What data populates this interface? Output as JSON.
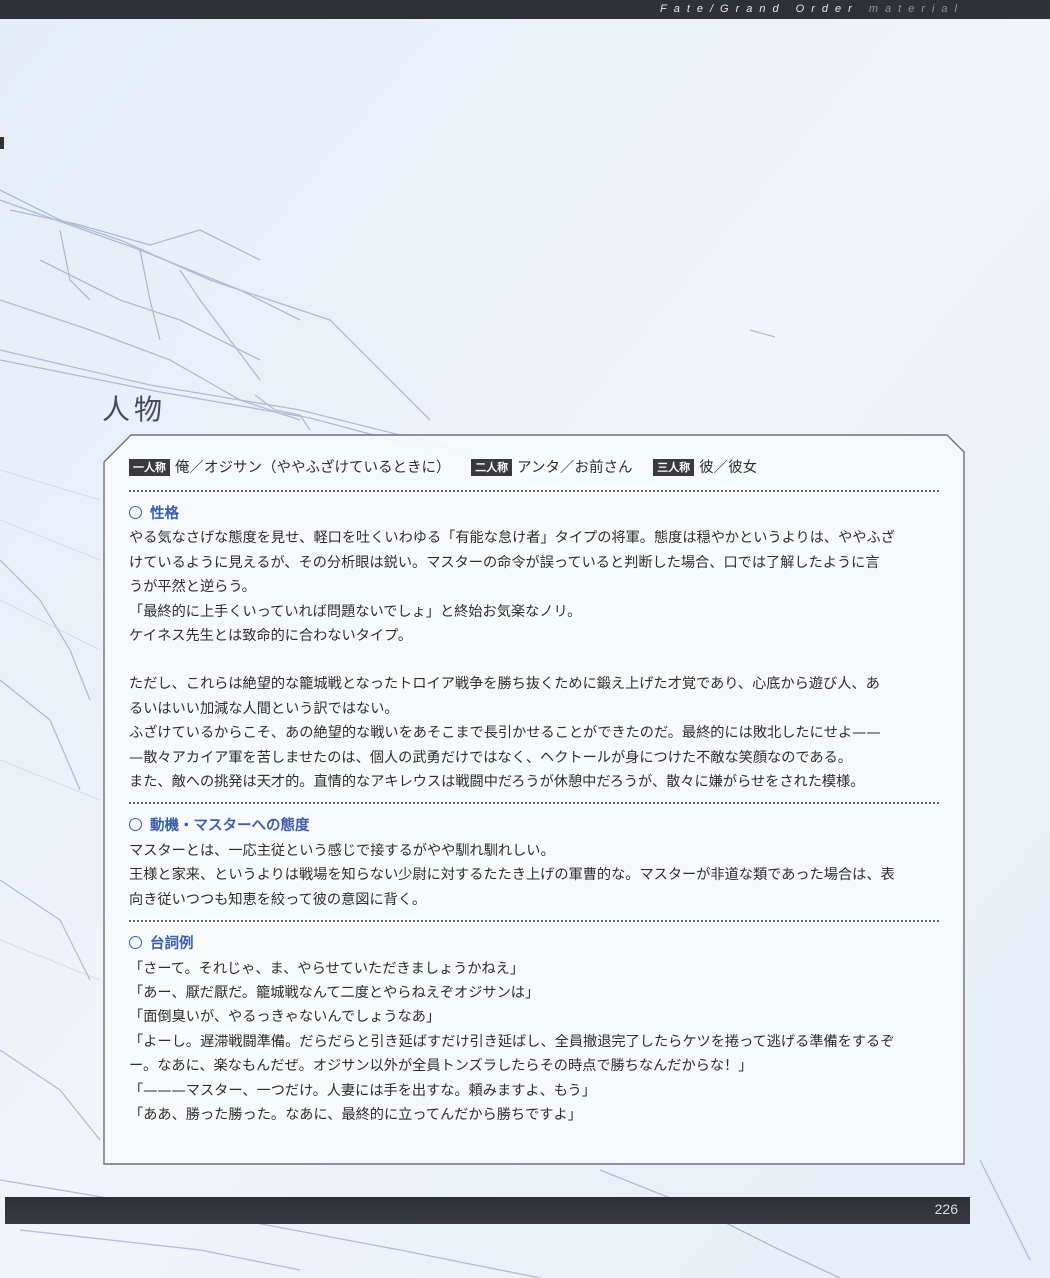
{
  "header": {
    "series_bright": "Fate/Grand Order",
    "series_dim": "material"
  },
  "section_title": "人物",
  "pronouns": {
    "first_label": "一人称",
    "first_value": "俺／オジサン（ややふざけているときに）",
    "second_label": "二人称",
    "second_value": "アンタ／お前さん",
    "third_label": "三人称",
    "third_value": "彼／彼女"
  },
  "personality": {
    "heading": "性格",
    "lines": [
      "やる気なさげな態度を見せ、軽口を吐くいわゆる「有能な怠け者」タイプの将軍。態度は穏やかというよりは、ややふざ",
      "けているように見えるが、その分析眼は鋭い。マスターの命令が誤っていると判断した場合、口では了解したように言",
      "うが平然と逆らう。",
      "「最終的に上手くいっていれば問題ないでしょ」と終始お気楽なノリ。",
      "ケイネス先生とは致命的に合わないタイプ。"
    ],
    "lines2": [
      "ただし、これらは絶望的な籠城戦となったトロイア戦争を勝ち抜くために鍛え上げた才覚であり、心底から遊び人、あ",
      "るいはいい加減な人間という訳ではない。",
      "ふざけているからこそ、あの絶望的な戦いをあそこまで長引かせることができたのだ。最終的には敗北したにせよ——",
      "—散々アカイア軍を苦しませたのは、個人の武勇だけではなく、ヘクトールが身につけた不敵な笑顔なのである。",
      "また、敵への挑発は天才的。直情的なアキレウスは戦闘中だろうが休憩中だろうが、散々に嫌がらせをされた模様。"
    ]
  },
  "motivation": {
    "heading": "動機・マスターへの態度",
    "lines": [
      "マスターとは、一応主従という感じで接するがやや馴れ馴れしい。",
      "王様と家来、というよりは戦場を知らない少尉に対するたたき上げの軍曹的な。マスターが非道な類であった場合は、表",
      "向き従いつつも知恵を絞って彼の意図に背く。"
    ]
  },
  "quotes": {
    "heading": "台詞例",
    "lines": [
      "「さーて。それじゃ、ま、やらせていただきましょうかねえ」",
      "「あー、厭だ厭だ。籠城戦なんて二度とやらねえぞオジサンは」",
      "「面倒臭いが、やるっきゃないんでしょうなあ」",
      "「よーし。遅滞戦闘準備。だらだらと引き延ばすだけ引き延ばし、全員撤退完了したらケツを捲って逃げる準備をするぞ",
      "ー。なあに、楽なもんだぜ。オジサン以外が全員トンズラしたらその時点で勝ちなんだからな！」",
      "「———マスター、一つだけ。人妻には手を出すな。頼みますよ、もう」",
      "「ああ、勝った勝った。なあに、最終的に立ってんだから勝ちですよ」"
    ]
  },
  "footer": {
    "page_number": "226"
  },
  "colors": {
    "accent": "#3c5ea8",
    "bar": "#2f3038"
  }
}
